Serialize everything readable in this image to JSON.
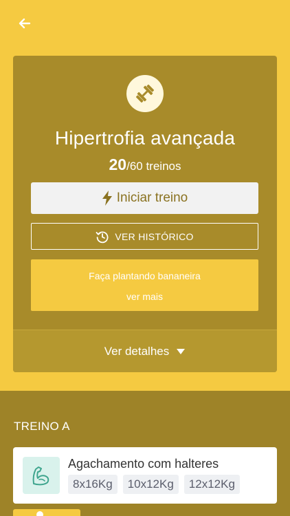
{
  "program": {
    "title": "Hipertrofia avançada",
    "completed": "20",
    "total_label": "/60 treinos"
  },
  "actions": {
    "start_label": "Iniciar treino",
    "history_label": "VER HISTÓRICO"
  },
  "tip": {
    "text": "Faça plantando bananeira",
    "more_label": "ver mais"
  },
  "details_label": "Ver detalhes",
  "section": {
    "title": "TREINO A",
    "exercise": {
      "name": "Agachamento com halteres",
      "sets": [
        "8x16Kg",
        "10x12Kg",
        "12x12Kg"
      ]
    }
  },
  "icons": {
    "back": "arrow-left-icon",
    "program": "dumbbell-icon",
    "start": "lightning-icon",
    "history": "history-clock-icon",
    "details": "caret-down-icon",
    "exercise": "flexed-arm-icon"
  },
  "colors": {
    "background": "#F5CA41",
    "card": "#A88B2A",
    "section": "#9E8328",
    "exercise_icon_bg": "#D9F2EC",
    "exercise_icon": "#3FA58E"
  }
}
